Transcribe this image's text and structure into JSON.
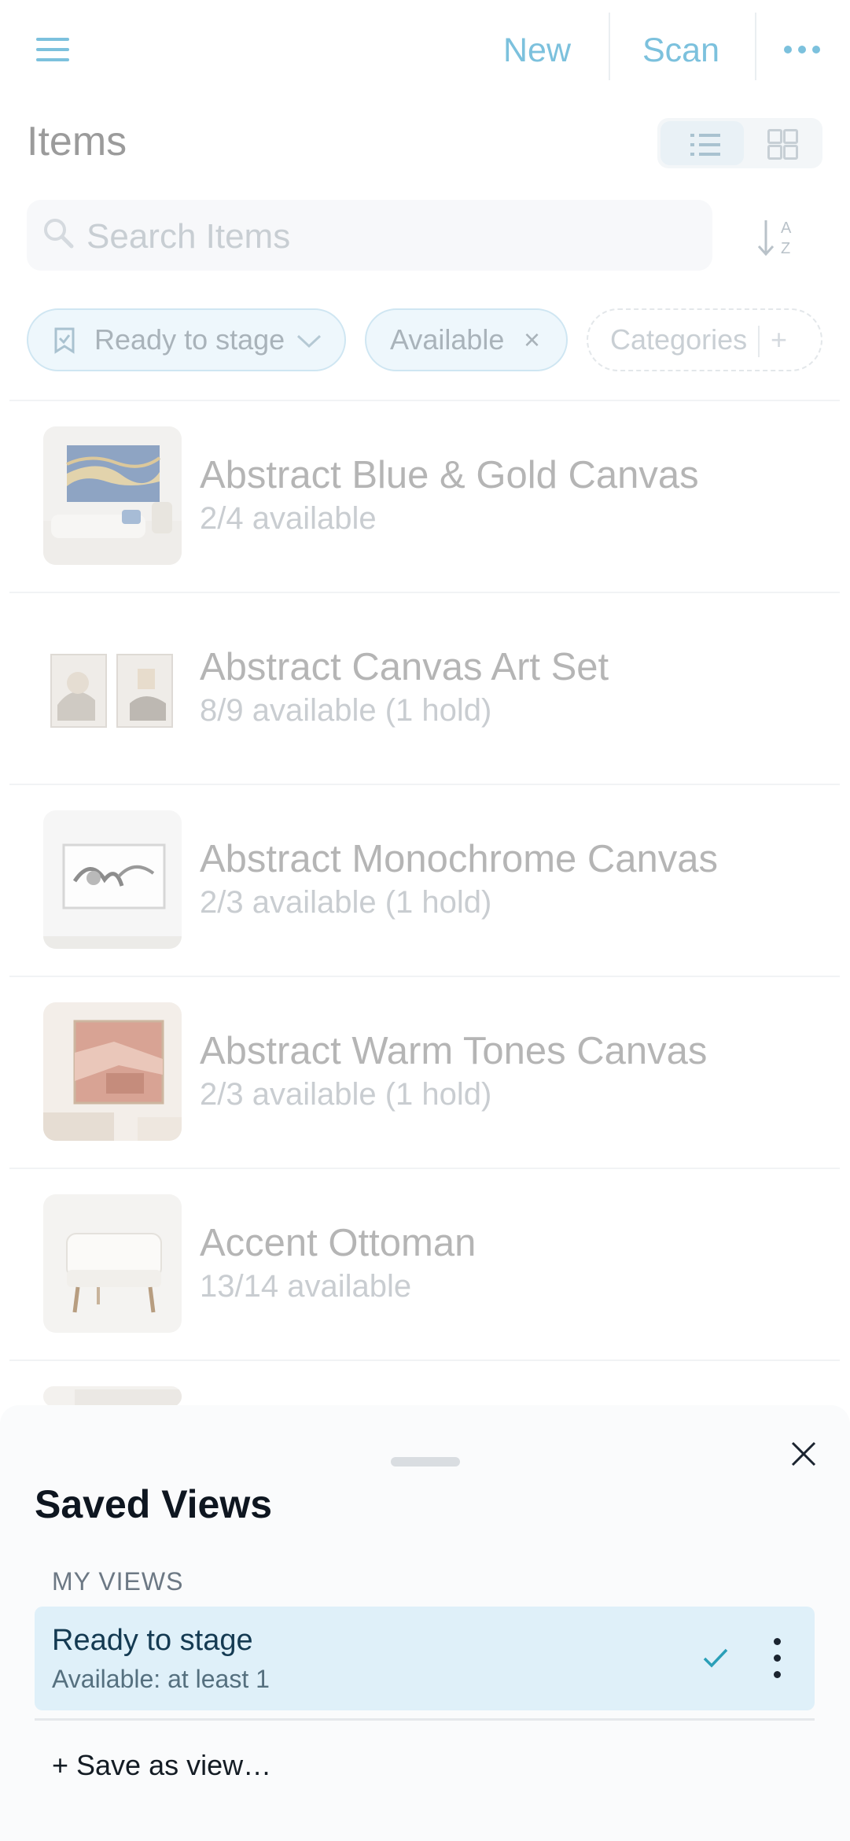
{
  "header": {
    "new_label": "New",
    "scan_label": "Scan",
    "menu_icon": "hamburger-menu-icon",
    "more_icon": "ellipsis-icon"
  },
  "page": {
    "title": "Items"
  },
  "search": {
    "placeholder": "Search Items"
  },
  "filters": {
    "view_chip_label": "Ready to stage",
    "availability_chip_label": "Available",
    "categories_chip_label": "Categories",
    "categories_add": "+",
    "remove_glyph": "×"
  },
  "items": [
    {
      "name": "Abstract Blue & Gold Canvas",
      "availability": "2/4 available"
    },
    {
      "name": "Abstract Canvas Art Set",
      "availability": "8/9 available (1 hold)"
    },
    {
      "name": "Abstract Monochrome Canvas",
      "availability": "2/3 available (1 hold)"
    },
    {
      "name": "Abstract Warm Tones Canvas",
      "availability": "2/3 available (1 hold)"
    },
    {
      "name": "Accent Ottoman",
      "availability": "13/14 available"
    }
  ],
  "saved_views": {
    "title": "Saved Views",
    "section_label": "MY VIEWS",
    "views": [
      {
        "name": "Ready to stage",
        "description": "Available: at least 1",
        "selected": true
      }
    ],
    "save_as_label": "+ Save as view…"
  },
  "colors": {
    "accent": "#7cc1dd",
    "selected_view_bg": "#dff0f9",
    "check": "#2a9fb8"
  }
}
